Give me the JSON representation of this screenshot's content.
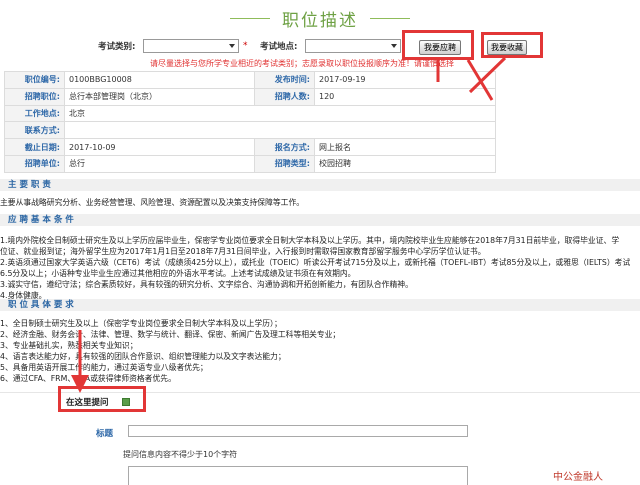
{
  "header": {
    "title": "职位描述"
  },
  "filters": {
    "exam_type_label": "考试类别:",
    "exam_location_label": "考试地点:",
    "required_mark": "*"
  },
  "buttons": {
    "apply": "我要应聘",
    "save": "我要收藏"
  },
  "notice": "请尽量选择与您所学专业相近的考试类别；志愿录取以职位投报顺序为准！请谨慎选择",
  "info": {
    "position_no_label": "职位编号:",
    "position_no": "0100BBG10008",
    "publish_time_label": "发布时间:",
    "publish_time": "2017-09-19",
    "position_label": "招聘职位:",
    "position": "总行本部管理岗（北京）",
    "headcount_label": "招聘人数:",
    "headcount": "120",
    "work_location_label": "工作地点:",
    "work_location": "北京",
    "contact_label": "联系方式:",
    "contact": "",
    "deadline_label": "截止日期:",
    "deadline": "2017-10-09",
    "apply_method_label": "报名方式:",
    "apply_method": "网上报名",
    "unit_label": "招聘单位:",
    "unit": "总行",
    "recruit_type_label": "招聘类型:",
    "recruit_type": "校园招聘"
  },
  "sections": {
    "duties_title": "主 要 职 责",
    "duties_text": "主要从事战略研究分析、业务经营管理、风险管理、资源配置以及决策支持保障等工作。",
    "requirements_title": "应 聘 基 本 条 件",
    "requirements_text": [
      "1.境内外院校全日制硕士研究生及以上学历应届毕业生，保密学专业岗位要求全日制大学本科及以上学历。其中，境内院校毕业生应能够在2018年7月31日前毕业，取得毕业证、学",
      "位证、就业报到证；海外留学生应为2017年1月1日至2018年7月31日间毕业，入行报到时需取得国家教育部留学服务中心学历学位认证书。",
      "2.英语须通过国家大学英语六级（CET6）考试（成绩须425分以上），或托业（TOEIC）听读公开考试715分及以上，或新托福（TOEFL-IBT）考试85分及以上，或雅思（IELTS）考试",
      "6.5分及以上；小语种专业毕业生应通过其他相应的外语水平考试。上述考试成绩及证书须在有效期内。",
      "3.诚实守信，遵纪守法；综合素质较好，具有较强的研究分析、文字综合、沟通协调和开拓创新能力，有团队合作精神。",
      "4.身体健康。"
    ],
    "specific_title": "职 位 具 体 要 求",
    "specific_text": [
      "1、全日制硕士研究生及以上（保密学专业岗位要求全日制大学本科及以上学历）；",
      "2、经济金融、财务会计、法律、管理、数学与统计、翻译、保密、新闻广告及理工科等相关专业；",
      "3、专业基础扎实，熟悉相关专业知识；",
      "4、语言表达能力好，具有较强的团队合作意识、组织管理能力以及文字表达能力；",
      "5、具备用英语开展工作的能力，通过英语专业八级者优先；",
      "6、通过CFA、FRM、CPA或获得律师资格者优先。"
    ]
  },
  "ask": {
    "label": "在这里提问",
    "title_label": "标题",
    "hint": "提问信息内容不得少于10个字符"
  },
  "watermark": "中公金融人",
  "colors": {
    "accent": "#6ea144",
    "highlight": "#e23636",
    "label": "#2e68a8",
    "notice": "#e03030"
  }
}
